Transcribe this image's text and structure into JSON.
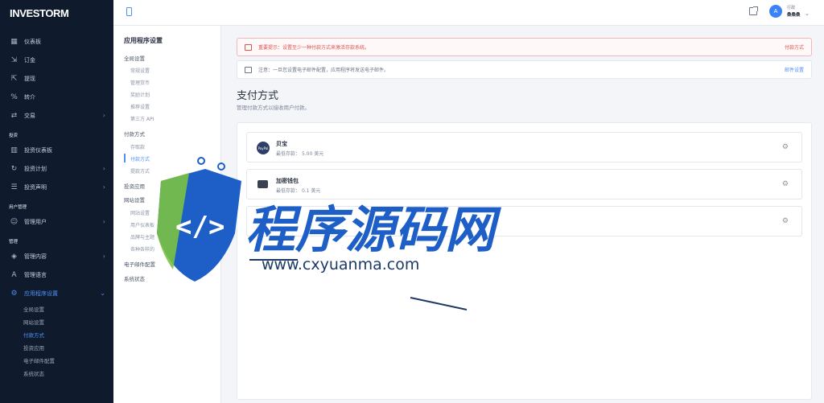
{
  "app": {
    "logo": "INVESTORM"
  },
  "sidebar": {
    "items": [
      {
        "label": "仪表板",
        "icon": "dashboard-icon",
        "glyph": "▦",
        "chevron": false
      },
      {
        "label": "订金",
        "icon": "deposit-icon",
        "glyph": "⇲",
        "chevron": false
      },
      {
        "label": "提现",
        "icon": "withdraw-icon",
        "glyph": "⇱",
        "chevron": false
      },
      {
        "label": "转介",
        "icon": "referral-icon",
        "glyph": "%",
        "chevron": false
      },
      {
        "label": "交易",
        "icon": "transaction-icon",
        "glyph": "⇄",
        "chevron": true
      }
    ],
    "section_invest": "投资",
    "invest_items": [
      {
        "label": "投资仪表板",
        "icon": "chart-icon",
        "glyph": "▥",
        "chevron": false
      },
      {
        "label": "投资计划",
        "icon": "plan-icon",
        "glyph": "↻",
        "chevron": true
      },
      {
        "label": "投资声明",
        "icon": "statement-icon",
        "glyph": "☰",
        "chevron": true
      }
    ],
    "section_users": "用户管理",
    "user_items": [
      {
        "label": "管理用户",
        "icon": "users-icon",
        "glyph": "☺",
        "chevron": true
      }
    ],
    "section_manage": "管理",
    "manage_items": [
      {
        "label": "管理内容",
        "icon": "content-icon",
        "glyph": "◈",
        "chevron": true
      },
      {
        "label": "管理语言",
        "icon": "language-icon",
        "glyph": "A",
        "chevron": false
      },
      {
        "label": "应用程序设置",
        "icon": "settings-icon",
        "glyph": "⚙",
        "chevron": true,
        "active": true
      }
    ],
    "sub_items": [
      {
        "label": "全局设置",
        "active": false
      },
      {
        "label": "网站设置",
        "active": false
      },
      {
        "label": "付款方式",
        "active": true
      },
      {
        "label": "投资应用",
        "active": false
      },
      {
        "label": "电子邮件配置",
        "active": false
      },
      {
        "label": "系统状态",
        "active": false
      }
    ]
  },
  "topbar": {
    "user_name": "行政",
    "user_role": "桑桑桑",
    "avatar_letter": "A"
  },
  "subpanel": {
    "title": "应用程序设置",
    "group_global": "全局设置",
    "global_items": [
      "常规设置",
      "管理货币",
      "奖励计划",
      "推荐设置",
      "第三方 API"
    ],
    "group_payment": "付款方式",
    "payment_items": [
      "存取款",
      "付款方式",
      "提款方式"
    ],
    "group_invest": "投资应用",
    "group_website": "网站设置",
    "website_items": [
      "网站设置",
      "用户仪表板",
      "品牌与主题",
      "各种各样的"
    ],
    "group_email": "电子邮件配置",
    "group_system": "系统状态"
  },
  "main": {
    "alert_danger_text": "重要提示：设置至少一种付款方式来激活存款系统。",
    "alert_danger_link": "付款方式",
    "alert_info_text": "注意：一旦您设置电子邮件配置，应用程序将发送电子邮件。",
    "alert_info_link": "邮件设置",
    "heading": "支付方式",
    "subheading": "管理付款方式以接收用户付款。",
    "methods": [
      {
        "name": "贝宝",
        "min_label": "最低存款：",
        "min_value": "5.00 美元",
        "icon": "paypal-icon",
        "logo_text": "PayPal"
      },
      {
        "name": "加密钱包",
        "min_label": "最低存款：",
        "min_value": "0.1 美元",
        "icon": "wallet-icon"
      },
      {
        "name": "",
        "min_label": "",
        "min_value": "",
        "icon": ""
      }
    ]
  },
  "watermark": {
    "title": "程序源码网",
    "url": "www.cxyuanma.com"
  },
  "colors": {
    "sidebar_bg": "#0f1b2d",
    "accent": "#4f8ff7",
    "danger": "#d9534f",
    "watermark_blue": "#1d5fc7",
    "watermark_green": "#7cc242"
  }
}
